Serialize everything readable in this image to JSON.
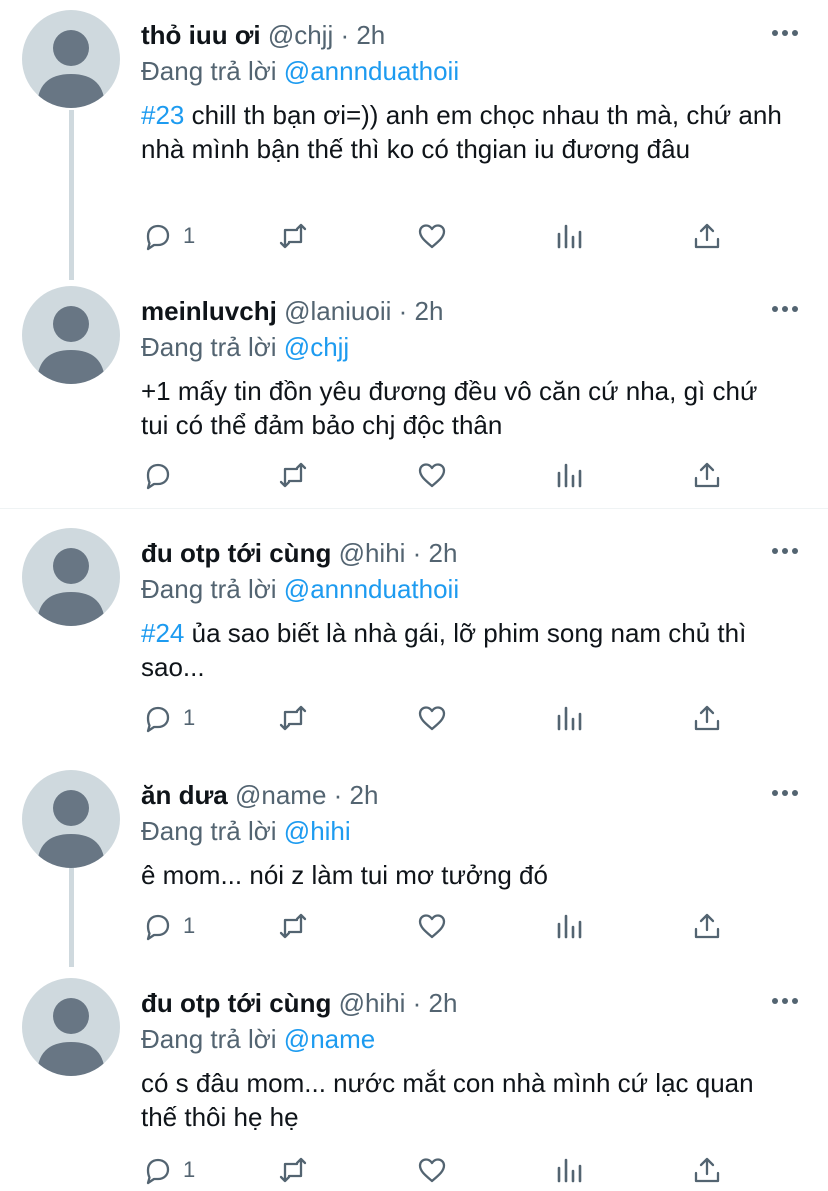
{
  "reply_prefix": "Đang trả lời",
  "colors": {
    "accent": "#1d9bf0",
    "secondary_text": "#536471",
    "avatar_bg": "#cfd9de",
    "avatar_fg": "#687684"
  },
  "tweets": [
    {
      "name": "thỏ iuu ơi",
      "handle": "@chjj",
      "time": "· 2h",
      "reply_to": "@annnduathoii",
      "hashtag": "#23",
      "text": " chill th bạn ơi=)) anh em chọc nhau th mà, chứ anh nhà mình bận thế thì ko có thgian iu đương đâu",
      "reply_count": "1"
    },
    {
      "name": "meinluvchj",
      "handle": "@laniuoii",
      "time": "· 2h",
      "reply_to": "@chjj",
      "hashtag": "",
      "text": "+1 mấy tin đồn yêu đương đều vô căn cứ nha, gì chứ tui có thể đảm bảo chj độc thân",
      "reply_count": ""
    },
    {
      "name": "đu otp tới cùng",
      "handle": "@hihi",
      "time": "· 2h",
      "reply_to": "@annnduathoii",
      "hashtag": "#24",
      "text": " ủa sao biết là nhà gái, lỡ phim song nam chủ thì sao...",
      "reply_count": "1"
    },
    {
      "name": "ăn dưa",
      "handle": "@name",
      "time": "· 2h",
      "reply_to": "@hihi",
      "hashtag": "",
      "text": "ê mom... nói z làm tui mơ tưởng đó",
      "reply_count": "1"
    },
    {
      "name": "đu otp tới cùng",
      "handle": "@hihi",
      "time": "· 2h",
      "reply_to": "@name",
      "hashtag": "",
      "text": "có s đâu mom... nước mắt con nhà mình cứ lạc quan thế thôi hẹ hẹ",
      "reply_count": "1"
    }
  ],
  "icons": [
    "more-icon",
    "reply-icon",
    "retweet-icon",
    "like-icon",
    "analytics-icon",
    "share-icon"
  ]
}
